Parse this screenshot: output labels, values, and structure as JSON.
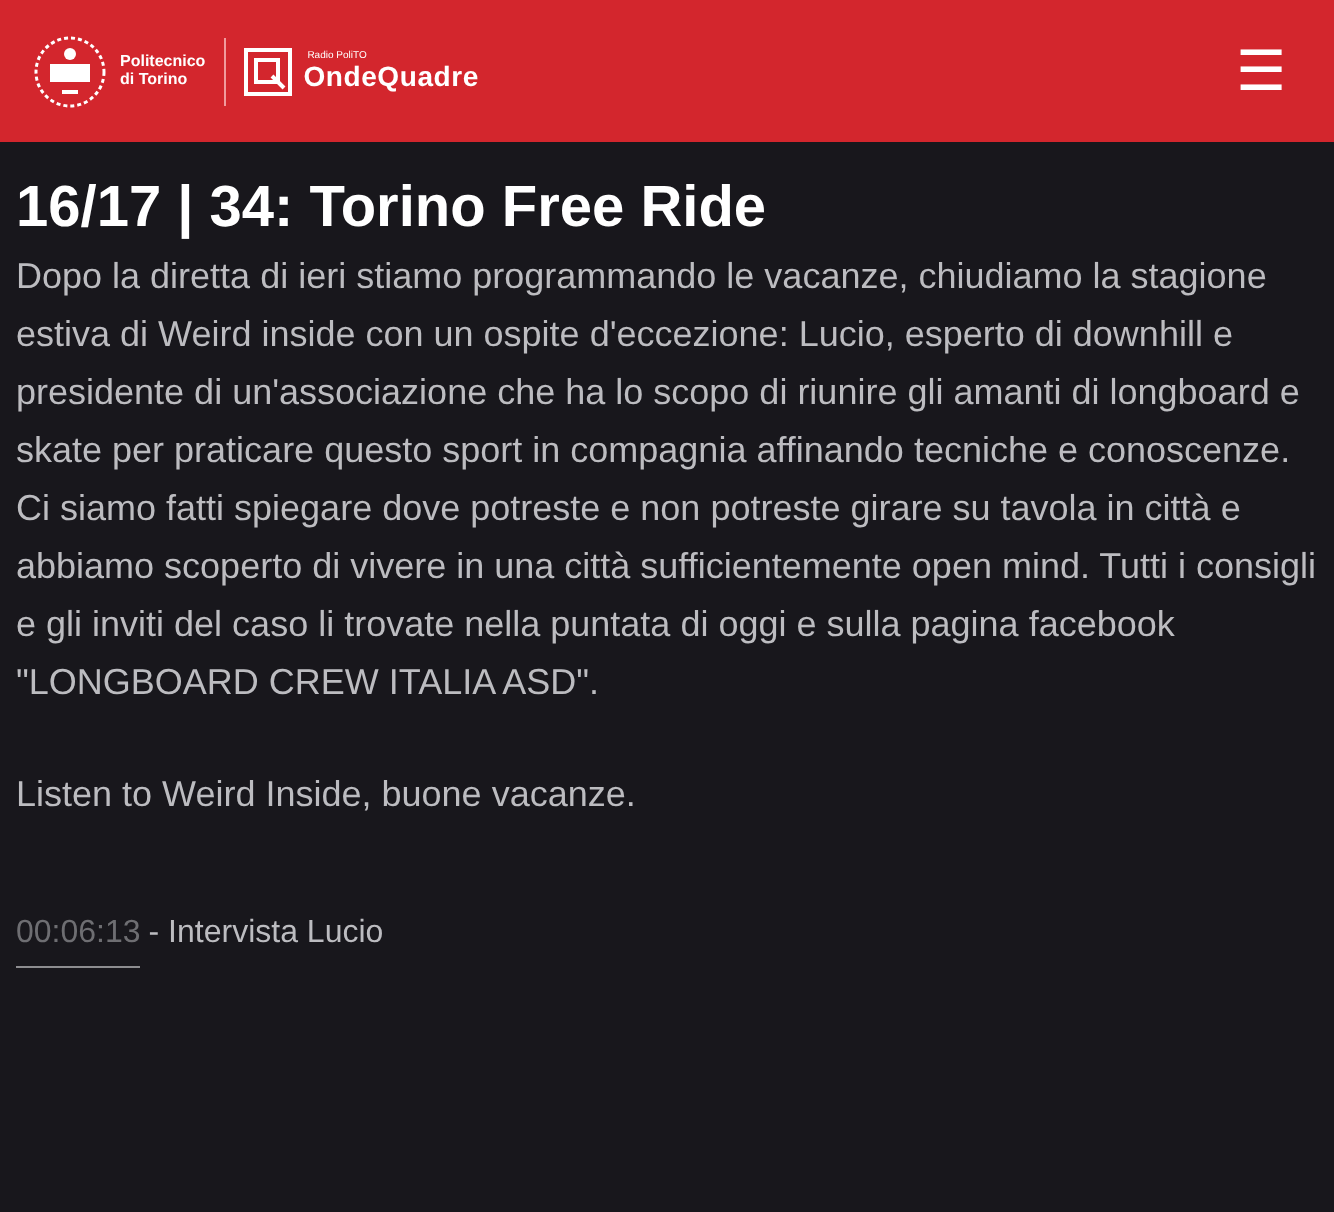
{
  "header": {
    "logo_line1": "Politecnico",
    "logo_line2": "di Torino",
    "radio_small": "Radio PoliTO",
    "radio_name": "OndeQuadre",
    "menu_icon": "☰"
  },
  "article": {
    "title": "16/17 | 34: Torino Free Ride",
    "paragraphs": [
      "Dopo la diretta di ieri stiamo programmando le vacanze, chiudiamo la stagione estiva di Weird inside con un ospite d'eccezione: Lucio, esperto di downhill e presidente di un'associazione che ha lo scopo di riunire gli amanti di longboard e skate per praticare questo sport in compagnia affinando tecniche e conoscenze. Ci siamo fatti spiegare dove potreste e non potreste girare su tavola in città e abbiamo scoperto di vivere in una città sufficientemente open mind. Tutti i consigli e gli inviti del caso li trovate nella puntata di oggi e sulla pagina facebook \"LONGBOARD CREW ITALIA ASD\".",
      "Listen to Weird Inside, buone vacanze."
    ],
    "chapters": [
      {
        "time": "00:06:13",
        "label": "- Intervista Lucio"
      }
    ]
  }
}
